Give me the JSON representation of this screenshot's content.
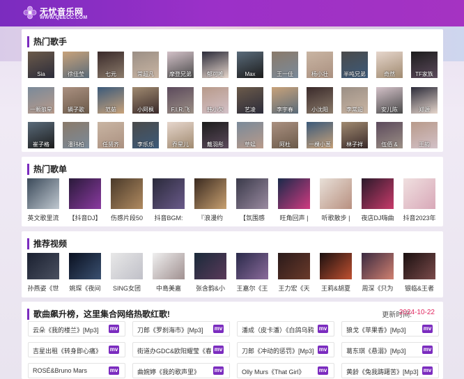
{
  "header": {
    "site_name": "无忧音乐网",
    "domain": "WWW.QEECC.COM",
    "logo_icon": "music-flower-logo"
  },
  "hot_singers": {
    "title": "热门歌手",
    "rows": [
      [
        "Sia",
        "徐佳莹",
        "七元",
        "常超凡",
        "摩登兄弟",
        "郁可唯",
        "Max",
        "王一佳",
        "杨小壮",
        "半吨兄弟",
        "奇然",
        "TF家族"
      ],
      [
        "一颗狼星",
        "辆子歌",
        "范茹",
        "小阿枫",
        "F.I.R.飞",
        "韩小欠",
        "艺凌",
        "李宇春",
        "小沈阳",
        "李常超",
        "安儿陈",
        "郑源"
      ],
      [
        "崔子格",
        "潘玮柏",
        "任贤齐",
        "李乐乐",
        "乔星儿",
        "戴羽彤",
        "草蜢",
        "阿杜",
        "一棵小葱",
        "林子祥",
        "伍佰 &",
        "王韵"
      ]
    ]
  },
  "hot_playlists": {
    "title": "热门歌单",
    "items": [
      "英文歌里流",
      "【抖音DJ】",
      "伤感片段50",
      "抖音BGM:",
      "『浪漫约",
      "【氛围感",
      "旺角回声 |",
      "听歌散步 |",
      "夜店DJ嗨曲",
      "抖音2023年"
    ]
  },
  "recommended_videos": {
    "title": "推荐视频",
    "items": [
      "孙燕姿《世",
      "姚琛《夜间",
      "SING女团",
      "中島美嘉",
      "张含韵&小",
      "王嘉尔《王",
      "王力宏《天",
      "王莉&胡夏",
      "周深《只为",
      "银临&王者"
    ]
  },
  "song_chart": {
    "title": "歌曲飙升榜，这里集合网络热歌红歌!",
    "update_label": "更新时间:",
    "update_date": "2024-10-22",
    "mv_label": "mv",
    "rows": [
      [
        "云朵《我的楼兰》[Mp3]",
        "刀郎《罗刹海市》[Mp3]",
        "潘成（皮卡潘）《白鸽乌鸦",
        "狼戈《苹果香》[Mp3]"
      ],
      [
        "吉星出租《转身即心痛》",
        "街道办GDC&欧阳耀莹《春",
        "刀郎《冲动的惩罚》[Mp3]",
        "葛东琪《悬溺》[Mp3]"
      ],
      [
        "ROSÉ&Bruno Mars",
        "曲婉婷《我的歌声里》",
        "Olly Murs《That Girl》",
        "黄龄《兔我踌躇苦》[Mp3]"
      ]
    ]
  },
  "colors": {
    "brand": "#7b2cbf",
    "date": "#e0245e"
  }
}
